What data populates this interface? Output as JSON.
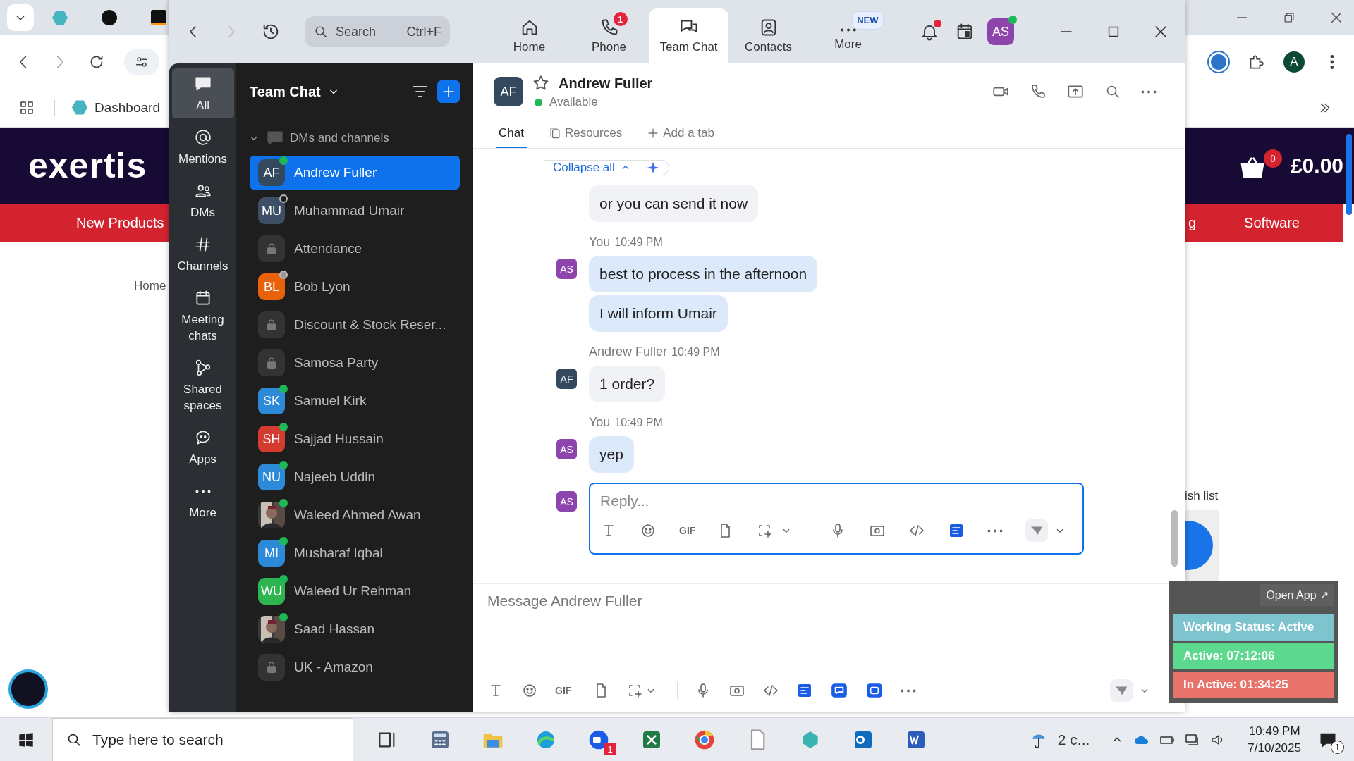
{
  "browser": {
    "bookmark": "Dashboard",
    "logo": "exertis",
    "nav_left": "New Products",
    "nav_right_partial": "g",
    "nav_right": "Software",
    "breadcrumb": "Home",
    "cart_count": "0",
    "cart_total": "£0.00",
    "wish_list": "ish list",
    "profile_initial": "A"
  },
  "app": {
    "search": {
      "placeholder": "Search",
      "shortcut": "Ctrl+F"
    },
    "nav_tabs": [
      {
        "label": "Home",
        "selected": false
      },
      {
        "label": "Phone",
        "selected": false,
        "badge": "1"
      },
      {
        "label": "Team Chat",
        "selected": true
      },
      {
        "label": "Contacts",
        "selected": false
      },
      {
        "label": "More",
        "selected": false,
        "badge": "NEW"
      }
    ],
    "notifications_unread": true,
    "user": {
      "initials": "AS",
      "online": true
    },
    "rail": [
      {
        "label": "All",
        "selected": true
      },
      {
        "label": "Mentions",
        "selected": false
      },
      {
        "label": "DMs",
        "selected": false
      },
      {
        "label": "Channels",
        "selected": false
      },
      {
        "label": "Meeting chats",
        "selected": false
      },
      {
        "label": "Shared spaces",
        "selected": false
      },
      {
        "label": "Apps",
        "selected": false
      },
      {
        "label": "More",
        "selected": false
      }
    ],
    "panel": {
      "title": "Team Chat",
      "section": "DMs and channels",
      "section_expanded": true,
      "items": [
        {
          "kind": "person",
          "name": "Andrew Fuller",
          "initials": "AF",
          "color": "#34495e",
          "online": true,
          "selected": true
        },
        {
          "kind": "person",
          "name": "Muhammad Umair",
          "initials": "MU",
          "color": "#3d4f66",
          "online": false,
          "away": false,
          "selected": false
        },
        {
          "kind": "channel",
          "name": "Attendance",
          "selected": false
        },
        {
          "kind": "person",
          "name": "Bob Lyon",
          "initials": "BL",
          "color": "#e8620c",
          "online": false,
          "away": true,
          "selected": false
        },
        {
          "kind": "channel",
          "name": "Discount & Stock Reser...",
          "selected": false
        },
        {
          "kind": "channel",
          "name": "Samosa Party",
          "selected": false
        },
        {
          "kind": "person",
          "name": "Samuel Kirk",
          "initials": "SK",
          "color": "#2d8ad9",
          "online": true,
          "selected": false
        },
        {
          "kind": "person",
          "name": "Sajjad Hussain",
          "initials": "SH",
          "color": "#d63b2f",
          "online": true,
          "selected": false
        },
        {
          "kind": "person",
          "name": "Najeeb Uddin",
          "initials": "NU",
          "color": "#2d8ad9",
          "online": true,
          "selected": false
        },
        {
          "name": "Waleed Ahmed Awan",
          "online": true,
          "selected": false
        },
        {
          "kind": "person",
          "name": "Musharaf Iqbal",
          "initials": "MI",
          "color": "#2d8ad9",
          "online": true,
          "selected": false
        },
        {
          "kind": "person",
          "name": "Waleed Ur Rehman",
          "initials": "WU",
          "color": "#2fb54f",
          "online": true,
          "selected": false
        },
        {
          "name": "Saad Hassan",
          "online": true,
          "selected": false
        },
        {
          "kind": "channel",
          "name": "UK - Amazon",
          "selected": false
        }
      ]
    },
    "conversation": {
      "name": "Andrew Fuller",
      "initials": "AF",
      "presence": "Available",
      "starred": false,
      "tabs": [
        {
          "label": "Chat",
          "selected": true
        },
        {
          "label": "Resources",
          "selected": false
        },
        {
          "label": "Add a tab",
          "selected": false
        }
      ],
      "collapse_label": "Collapse all",
      "groups": [
        {
          "kind": "received",
          "bubbles": [
            "or you can send it now"
          ]
        },
        {
          "kind": "sent",
          "author": "You",
          "time": "10:49 PM",
          "initials": "AS",
          "bubbles": [
            "best to process in the afternoon",
            "I will inform Umair"
          ]
        },
        {
          "kind": "received",
          "author": "Andrew Fuller",
          "time": "10:49 PM",
          "initials": "AF",
          "bubbles": [
            "1 order?"
          ]
        },
        {
          "kind": "sent",
          "author": "You",
          "time": "10:49 PM",
          "initials": "AS",
          "bubbles": [
            "yep"
          ]
        }
      ],
      "reply": {
        "initials": "AS",
        "placeholder": "Reply...",
        "gif_label": "GIF"
      },
      "composer": {
        "placeholder": "Message Andrew Fuller",
        "gif_label": "GIF"
      }
    }
  },
  "tracker": {
    "open_label": "Open App ↗",
    "rows": [
      {
        "text": "Working Status: Active",
        "color": "#7ec4cf"
      },
      {
        "text": "Active: 07:12:06",
        "color": "#5dd98f"
      },
      {
        "text": "In Active: 01:34:25",
        "color": "#e8736a"
      }
    ]
  },
  "taskbar": {
    "search_placeholder": "Type here to search",
    "zoom_badge": "1",
    "weather": "2 c...",
    "time": "10:49 PM",
    "date": "7/10/2025",
    "notifications": "1"
  }
}
